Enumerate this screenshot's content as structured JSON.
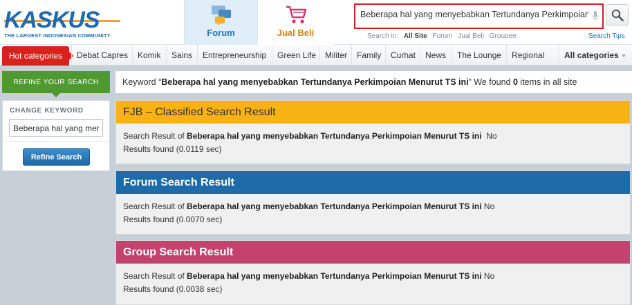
{
  "header": {
    "logo_text": "KASKUS",
    "logo_tagline": "THE LARGEST INDONESIAN COMMUNITY",
    "tab_forum": "Forum",
    "tab_jual_beli": "Jual Beli",
    "search_value": "Beberapa hal yang menyebabkan Tertundanya Perkimpoian Menurut TS ini",
    "search_in_label": "Search in:",
    "search_scopes": [
      "All Site",
      "Forum",
      "Jual Beli",
      "Groupee"
    ],
    "search_tips": "Search Tips"
  },
  "categories": {
    "hot": "Hot categories",
    "items": [
      "Debat Capres",
      "Komik",
      "Sains",
      "Entrepreneurship",
      "Green Life",
      "Militer",
      "Family",
      "Curhat",
      "News",
      "The Lounge",
      "Regional"
    ],
    "all": "All categories"
  },
  "refine": {
    "tab_label": "REFINE YOUR SEARCH",
    "keyword_prefix": "Keyword “",
    "keyword": "Beberapa hal yang menyebabkan Tertundanya Perkimpoian Menurut TS ini",
    "keyword_mid": "” We found ",
    "count": "0",
    "keyword_suffix": " items in all site",
    "change_keyword_label": "CHANGE KEYWORD",
    "change_keyword_value": "Beberapa hal yang menyebabkan",
    "button": "Refine Search"
  },
  "results": [
    {
      "title": "FJB – Classified Search Result",
      "prefix": "Search Result of ",
      "keyword": "Beberapa hal yang menyebabkan Tertundanya Perkimpoian Menurut TS ini",
      "no": "  No",
      "found": "Results found (0.0119 sec)",
      "color": "#f7b214"
    },
    {
      "title": "Forum Search Result",
      "prefix": "Search Result of ",
      "keyword": "Beberapa hal yang menyebabkan Tertundanya Perkimpoian Menurut TS ini",
      "no": " No",
      "found": "Results found (0.0070 sec)",
      "color": "#1d6ca9"
    },
    {
      "title": "Group Search Result",
      "prefix": "Search Result of ",
      "keyword": "Beberapa hal yang menyebabkan Tertundanya Perkimpoian Menurut TS ini",
      "no": " No",
      "found": "Results found (0.0038 sec)",
      "color": "#c4436e"
    }
  ]
}
